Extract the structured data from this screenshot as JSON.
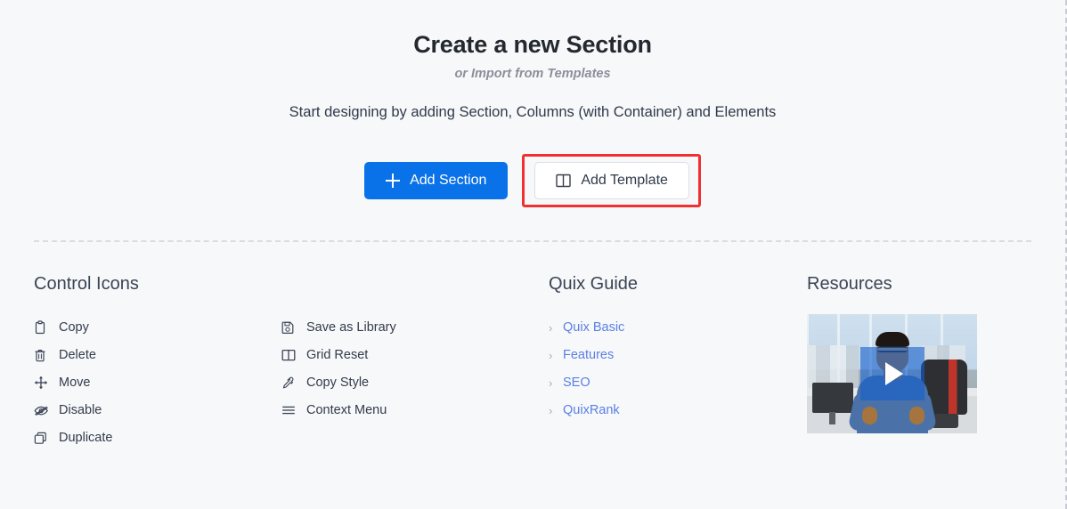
{
  "hero": {
    "title": "Create a new Section",
    "subtitle": "or Import from Templates",
    "description": "Start designing by adding Section, Columns (with Container) and Elements"
  },
  "actions": {
    "add_section_label": "Add Section",
    "add_template_label": "Add Template",
    "primary_color": "#0a72e8",
    "highlight_color": "#f23030",
    "plus_icon": "plus-icon",
    "template_icon": "template-columns-icon"
  },
  "control_icons": {
    "title": "Control Icons",
    "left": [
      {
        "label": "Copy",
        "icon": "clipboard-icon"
      },
      {
        "label": "Delete",
        "icon": "trash-icon"
      },
      {
        "label": "Move",
        "icon": "move-arrows-icon"
      },
      {
        "label": "Disable",
        "icon": "eye-slash-icon"
      },
      {
        "label": "Duplicate",
        "icon": "duplicate-squares-icon"
      }
    ],
    "right": [
      {
        "label": "Save as Library",
        "icon": "floppy-save-icon"
      },
      {
        "label": "Grid Reset",
        "icon": "grid-columns-icon"
      },
      {
        "label": "Copy Style",
        "icon": "eyedropper-icon"
      },
      {
        "label": "Context Menu",
        "icon": "hamburger-menu-icon"
      }
    ]
  },
  "guide": {
    "title": "Quix Guide",
    "link_color": "#5b7fe4",
    "chevron": "›",
    "links": [
      {
        "label": "Quix Basic"
      },
      {
        "label": "Features"
      },
      {
        "label": "SEO"
      },
      {
        "label": "QuixRank"
      }
    ]
  },
  "resources": {
    "title": "Resources",
    "video": {
      "play_icon": "play-triangle-icon",
      "overlay_color": "#145fcd"
    }
  }
}
